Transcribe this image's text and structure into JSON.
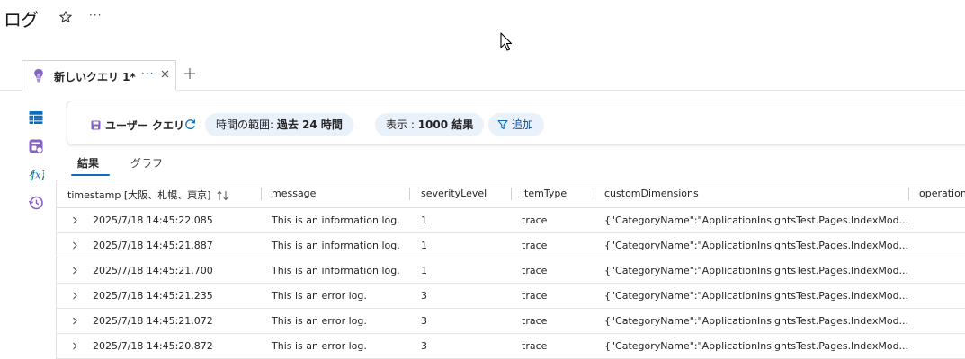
{
  "page": {
    "title": "ログ"
  },
  "query_tab": {
    "label": "新しいクエリ 1*",
    "more": "···"
  },
  "toolbar": {
    "user_query_label": "ユーザー クエリ",
    "time_range_label": "時間の範囲:",
    "time_range_value": "過去 24 時間",
    "display_label": "表示 :",
    "display_value": "1000 結果",
    "add_filter_label": "追加"
  },
  "result_tabs": {
    "results": "結果",
    "graph": "グラフ"
  },
  "grid": {
    "columns": [
      "timestamp [大阪、札幌、東京]",
      "message",
      "severityLevel",
      "itemType",
      "customDimensions",
      "operation"
    ],
    "rows": [
      {
        "timestamp": "2025/7/18 14:45:22.085",
        "message": "This is an information log.",
        "severityLevel": "1",
        "itemType": "trace",
        "customDimensions": "{\"CategoryName\":\"ApplicationInsightsTest.Pages.IndexMod..."
      },
      {
        "timestamp": "2025/7/18 14:45:21.887",
        "message": "This is an information log.",
        "severityLevel": "1",
        "itemType": "trace",
        "customDimensions": "{\"CategoryName\":\"ApplicationInsightsTest.Pages.IndexMod..."
      },
      {
        "timestamp": "2025/7/18 14:45:21.700",
        "message": "This is an information log.",
        "severityLevel": "1",
        "itemType": "trace",
        "customDimensions": "{\"CategoryName\":\"ApplicationInsightsTest.Pages.IndexMod..."
      },
      {
        "timestamp": "2025/7/18 14:45:21.235",
        "message": "This is an error log.",
        "severityLevel": "3",
        "itemType": "trace",
        "customDimensions": "{\"CategoryName\":\"ApplicationInsightsTest.Pages.IndexMod..."
      },
      {
        "timestamp": "2025/7/18 14:45:21.072",
        "message": "This is an error log.",
        "severityLevel": "3",
        "itemType": "trace",
        "customDimensions": "{\"CategoryName\":\"ApplicationInsightsTest.Pages.IndexMod..."
      },
      {
        "timestamp": "2025/7/18 14:45:20.872",
        "message": "This is an error log.",
        "severityLevel": "3",
        "itemType": "trace",
        "customDimensions": "{\"CategoryName\":\"ApplicationInsightsTest.Pages.IndexMod..."
      }
    ]
  },
  "colors": {
    "accent": "#0f6cbd",
    "pill_bg": "#e9f1fb",
    "tab_icon": "#8661c5"
  },
  "icons": {
    "header": [
      "star-icon",
      "more-icon"
    ],
    "tab": [
      "lightbulb-icon",
      "close-icon",
      "plus-icon"
    ],
    "rail": [
      "table-icon",
      "query-icon",
      "function-icon",
      "history-icon"
    ],
    "toolbar": [
      "save-icon",
      "refresh-icon",
      "filter-icon"
    ],
    "grid": [
      "sort-icon",
      "chevron-right-icon"
    ]
  }
}
